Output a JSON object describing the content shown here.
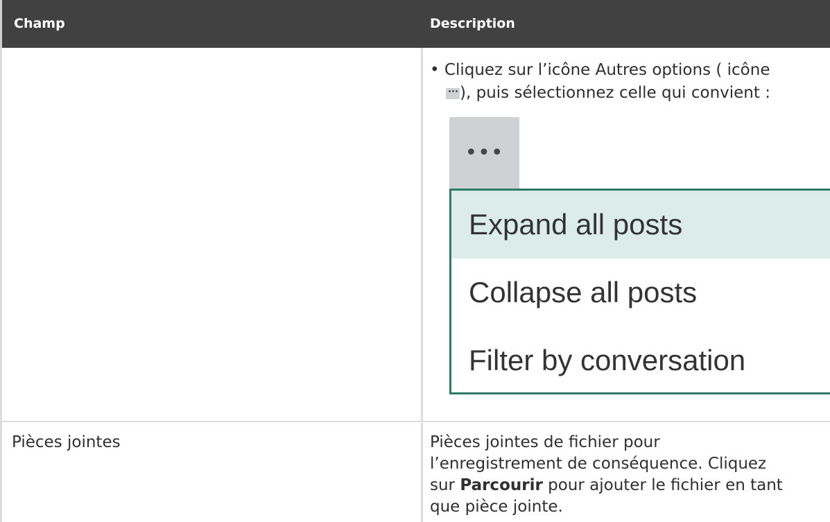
{
  "table": {
    "headers": [
      "Champ",
      "Description"
    ]
  },
  "row1": {
    "field": "",
    "bullet": "•",
    "line1": "Cliquez sur l’icône Autres options ( icône",
    "inline_icon": "•••",
    "line2": "), puis sélectionnez celle qui convient :",
    "more_button": "•••",
    "menu_items": [
      "Expand all posts",
      "Collapse all posts",
      "Filter by conversation"
    ]
  },
  "row2": {
    "field": "Pièces jointes",
    "desc_line1": "Pièces jointes de fichier pour",
    "desc_line2": "l’enregistrement de conséquence. Cliquez",
    "desc_line3_pre": "sur ",
    "desc_line3_bold": "Parcourir",
    "desc_line3_post": " pour ajouter le fichier en tant",
    "desc_line4": "que pièce jointe."
  },
  "colors": {
    "header_bg": "#414141",
    "menu_border": "#2f7a67",
    "menu_active_bg": "#dcece8",
    "icon_bg": "#cfd2d3"
  }
}
